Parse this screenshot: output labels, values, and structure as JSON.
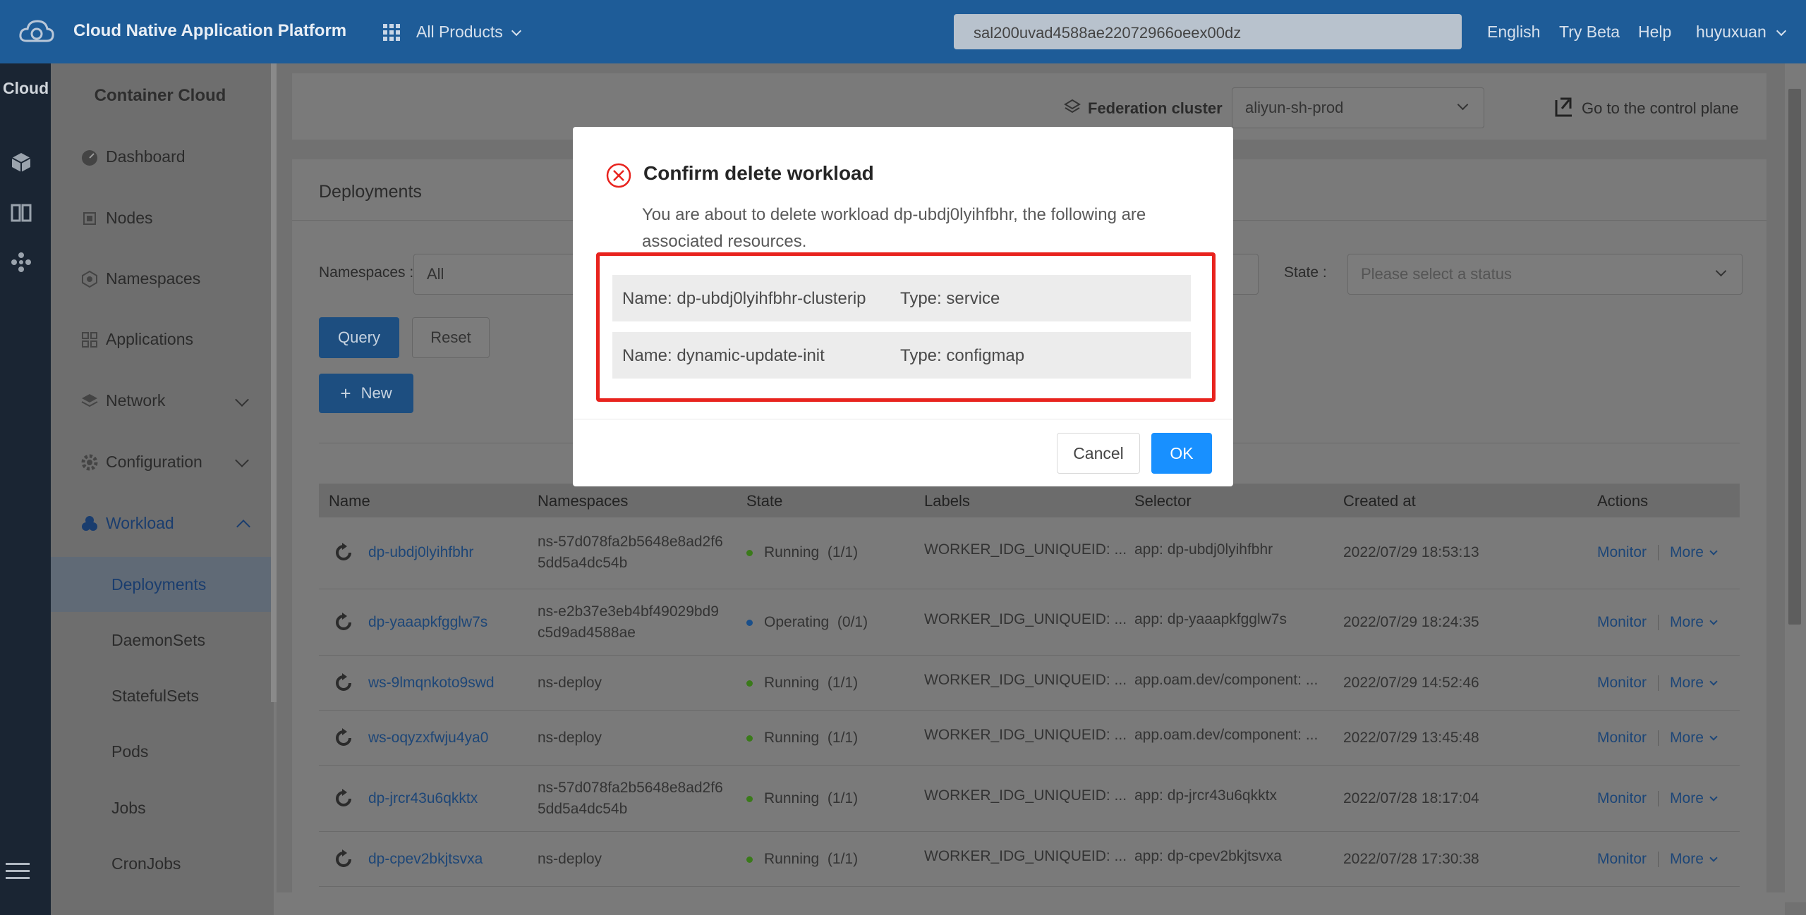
{
  "topbar": {
    "title": "Cloud Native Application Platform",
    "products": "All Products",
    "search_value": "sal200uvad4588ae22072966oeex00dz",
    "links": [
      "English",
      "Try Beta",
      "Help",
      "huyuxuan"
    ]
  },
  "rail": {
    "title": "Cloud"
  },
  "sidebar": {
    "title": "Container Cloud",
    "items": [
      {
        "label": "Dashboard"
      },
      {
        "label": "Nodes"
      },
      {
        "label": "Namespaces"
      },
      {
        "label": "Applications"
      },
      {
        "label": "Network"
      },
      {
        "label": "Configuration"
      },
      {
        "label": "Workload"
      }
    ],
    "sub_items": [
      "Deployments",
      "DaemonSets",
      "StatefulSets",
      "Pods",
      "Jobs",
      "CronJobs"
    ]
  },
  "federation": {
    "label": "Federation cluster",
    "cluster": "aliyun-sh-prod",
    "control_plane": "Go to the control plane"
  },
  "deployments": {
    "title": "Deployments",
    "namespaces_label": "Namespaces",
    "namespaces_value": "All",
    "state_label": "State",
    "state_placeholder": "Please select a status",
    "query": "Query",
    "reset": "Reset",
    "new": "New",
    "columns": [
      "Name",
      "Namespaces",
      "State",
      "Labels",
      "Selector",
      "Created at",
      "Actions"
    ],
    "rows": [
      {
        "name": "dp-ubdj0lyihfbhr",
        "ns1": "ns-57d078fa2b5648e8ad2f6",
        "ns2": "5dd5a4dc54b",
        "state": "Running",
        "count": "(1/1)",
        "state_color": "#3a7a1a",
        "labels": "WORKER_IDG_UNIQUEID: ...",
        "selector": "app: dp-ubdj0lyihfbhr",
        "created": "2022/07/29 18:53:13"
      },
      {
        "name": "dp-yaaapkfgglw7s",
        "ns1": "ns-e2b37e3eb4bf49029bd9",
        "ns2": "c5d9ad4588ae",
        "state": "Operating",
        "count": "(0/1)",
        "state_color": "#1a4f8a",
        "labels": "WORKER_IDG_UNIQUEID: ...",
        "selector": "app: dp-yaaapkfgglw7s",
        "created": "2022/07/29 18:24:35"
      },
      {
        "name": "ws-9lmqnkoto9swd",
        "ns1": "ns-deploy",
        "ns2": "",
        "state": "Running",
        "count": "(1/1)",
        "state_color": "#3a7a1a",
        "labels": "WORKER_IDG_UNIQUEID: ...",
        "selector": "app.oam.dev/component: ...",
        "created": "2022/07/29 14:52:46"
      },
      {
        "name": "ws-oqyzxfwju4ya0",
        "ns1": "ns-deploy",
        "ns2": "",
        "state": "Running",
        "count": "(1/1)",
        "state_color": "#3a7a1a",
        "labels": "WORKER_IDG_UNIQUEID: ...",
        "selector": "app.oam.dev/component: ...",
        "created": "2022/07/29 13:45:48"
      },
      {
        "name": "dp-jrcr43u6qkktx",
        "ns1": "ns-57d078fa2b5648e8ad2f6",
        "ns2": "5dd5a4dc54b",
        "state": "Running",
        "count": "(1/1)",
        "state_color": "#3a7a1a",
        "labels": "WORKER_IDG_UNIQUEID: ...",
        "selector": "app: dp-jrcr43u6qkktx",
        "created": "2022/07/28 18:17:04"
      },
      {
        "name": "dp-cpev2bkjtsvxa",
        "ns1": "ns-deploy",
        "ns2": "",
        "state": "Running",
        "count": "(1/1)",
        "state_color": "#3a7a1a",
        "labels": "WORKER_IDG_UNIQUEID: ...",
        "selector": "app: dp-cpev2bkjtsvxa",
        "created": "2022/07/28 17:30:38"
      }
    ],
    "monitor": "Monitor",
    "more": "More"
  },
  "modal": {
    "title": "Confirm delete workload",
    "body": "You are about to delete workload dp-ubdj0lyihfbhr, the following are associated resources.",
    "resources": [
      {
        "name": "Name: dp-ubdj0lyihfbhr-clusterip",
        "type": "Type: service"
      },
      {
        "name": "Name: dynamic-update-init",
        "type": "Type: configmap"
      }
    ],
    "cancel": "Cancel",
    "ok": "OK"
  },
  "colors": {
    "primary": "#1890ff",
    "danger": "#e8231e",
    "topbar": "#1e5c98"
  }
}
